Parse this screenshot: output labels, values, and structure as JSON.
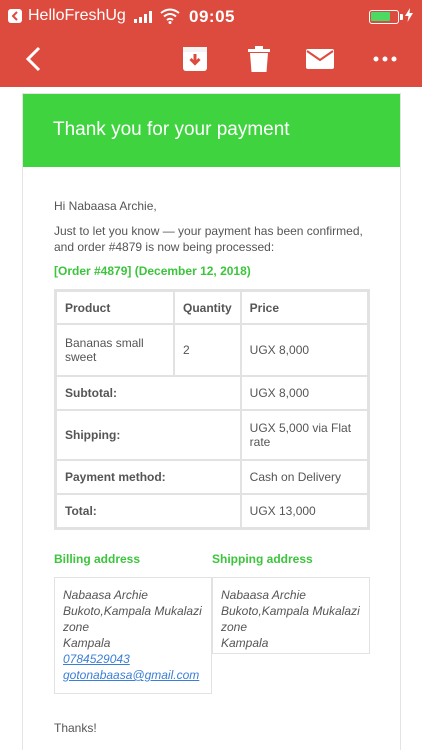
{
  "status_bar": {
    "carrier": "HelloFreshUg",
    "time": "09:05",
    "battery_color": "#4cd964"
  },
  "toolbar": {
    "background": "#dd4b3e",
    "icons": [
      "back-icon",
      "archive-icon",
      "trash-icon",
      "mail-icon",
      "more-icon"
    ]
  },
  "email": {
    "banner_title": "Thank you for your payment",
    "banner_color": "#3fd43f",
    "greeting": "Hi Nabaasa Archie,",
    "intro": "Just to let you know — your payment has been confirmed, and order #4879 is now being processed:",
    "order_heading": "[Order #4879] (December 12, 2018)",
    "table": {
      "headers": [
        "Product",
        "Quantity",
        "Price"
      ],
      "items": [
        {
          "product": "Bananas small sweet",
          "quantity": "2",
          "price": "UGX 8,000"
        }
      ],
      "totals": [
        {
          "label": "Subtotal:",
          "value": "UGX 8,000"
        },
        {
          "label": "Shipping:",
          "value": "UGX 5,000 via Flat rate"
        },
        {
          "label": "Payment method:",
          "value": "Cash on Delivery"
        },
        {
          "label": "Total:",
          "value": "UGX 13,000"
        }
      ]
    },
    "billing": {
      "title": "Billing address",
      "name": "Nabaasa Archie",
      "street": "Bukoto,Kampala Mukalazi zone",
      "city": "Kampala",
      "phone": "0784529043",
      "email": "gotonabaasa@gmail.com"
    },
    "shipping": {
      "title": "Shipping address",
      "name": "Nabaasa Archie",
      "street": "Bukoto,Kampala Mukalazi zone",
      "city": "Kampala"
    },
    "closing": "Thanks!"
  }
}
